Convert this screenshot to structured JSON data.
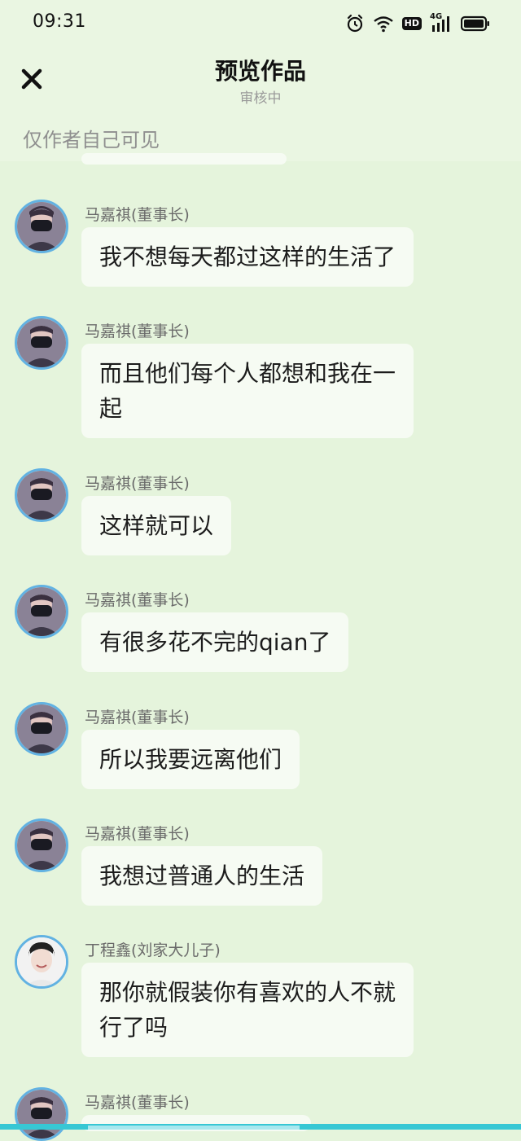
{
  "status_bar": {
    "time": "09:31",
    "icons": [
      "alarm-icon",
      "wifi-icon",
      "hd-icon",
      "signal-4g-icon",
      "battery-icon"
    ],
    "hd_label": "HD",
    "network_label": "4G"
  },
  "header": {
    "close_icon": "close-icon",
    "title": "预览作品",
    "subtitle": "审核中",
    "visibility_note": "仅作者自己可见"
  },
  "colors": {
    "background": "#e5f4dc",
    "bubble": "#f6fbf3",
    "avatar_ring": "#62b2e2",
    "bottom_bar": "#37c7d4"
  },
  "messages": [
    {
      "sender": "马嘉祺(董事长)",
      "avatar": "masked-person-avatar",
      "lines": [
        "我不想每天都过这样的生活了"
      ]
    },
    {
      "sender": "马嘉祺(董事长)",
      "avatar": "masked-person-avatar",
      "lines": [
        "而且他们每个人都想和我在一",
        "起"
      ]
    },
    {
      "sender": "马嘉祺(董事长)",
      "avatar": "masked-person-avatar",
      "lines": [
        "这样就可以"
      ]
    },
    {
      "sender": "马嘉祺(董事长)",
      "avatar": "masked-person-avatar",
      "lines": [
        "有很多花不完的qian了"
      ]
    },
    {
      "sender": "马嘉祺(董事长)",
      "avatar": "masked-person-avatar",
      "lines": [
        "所以我要远离他们"
      ]
    },
    {
      "sender": "马嘉祺(董事长)",
      "avatar": "masked-person-avatar",
      "lines": [
        "我想过普通人的生活"
      ]
    },
    {
      "sender": "丁程鑫(刘家大儿子)",
      "avatar": "smiling-person-avatar",
      "lines": [
        "那你就假装你有喜欢的人不就",
        "行了吗"
      ]
    },
    {
      "sender": "马嘉祺(董事长)",
      "avatar": "masked-person-avatar",
      "lines": [
        ""
      ]
    }
  ]
}
